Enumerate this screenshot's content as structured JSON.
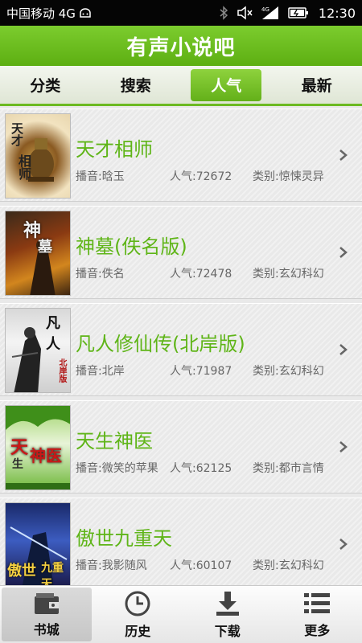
{
  "statusbar": {
    "carrier": "中国移动 4G",
    "network": "4G",
    "time": "12:30"
  },
  "app": {
    "title": "有声小说吧"
  },
  "tabs": [
    {
      "label": "分类",
      "active": false
    },
    {
      "label": "搜索",
      "active": false
    },
    {
      "label": "人气",
      "active": true
    },
    {
      "label": "最新",
      "active": false
    }
  ],
  "books": [
    {
      "title": "天才相师",
      "narrator": "播音:晗玉",
      "popularity": "人气:72672",
      "category": "类别:惊悚灵异",
      "cover_text": "天才相师"
    },
    {
      "title": "神墓(佚名版)",
      "narrator": "播音:佚名",
      "popularity": "人气:72478",
      "category": "类别:玄幻科幻",
      "cover_text": "神墓"
    },
    {
      "title": "凡人修仙传(北岸版)",
      "narrator": "播音:北岸",
      "popularity": "人气:71987",
      "category": "类别:玄幻科幻",
      "cover_text": "凡人修仙传"
    },
    {
      "title": "天生神医",
      "narrator": "播音:微笑的苹果",
      "popularity": "人气:62125",
      "category": "类别:都市言情",
      "cover_text": "天生神医"
    },
    {
      "title": "傲世九重天",
      "narrator": "播音:我影随风",
      "popularity": "人气:60107",
      "category": "类别:玄幻科幻",
      "cover_text": "傲世九重天"
    }
  ],
  "bottom_nav": [
    {
      "label": "书城",
      "icon": "wallet-icon",
      "active": true
    },
    {
      "label": "历史",
      "icon": "clock-icon",
      "active": false
    },
    {
      "label": "下载",
      "icon": "download-icon",
      "active": false
    },
    {
      "label": "更多",
      "icon": "list-icon",
      "active": false
    }
  ],
  "colors": {
    "accent": "#6cba22",
    "title_text": "#5fb518"
  }
}
